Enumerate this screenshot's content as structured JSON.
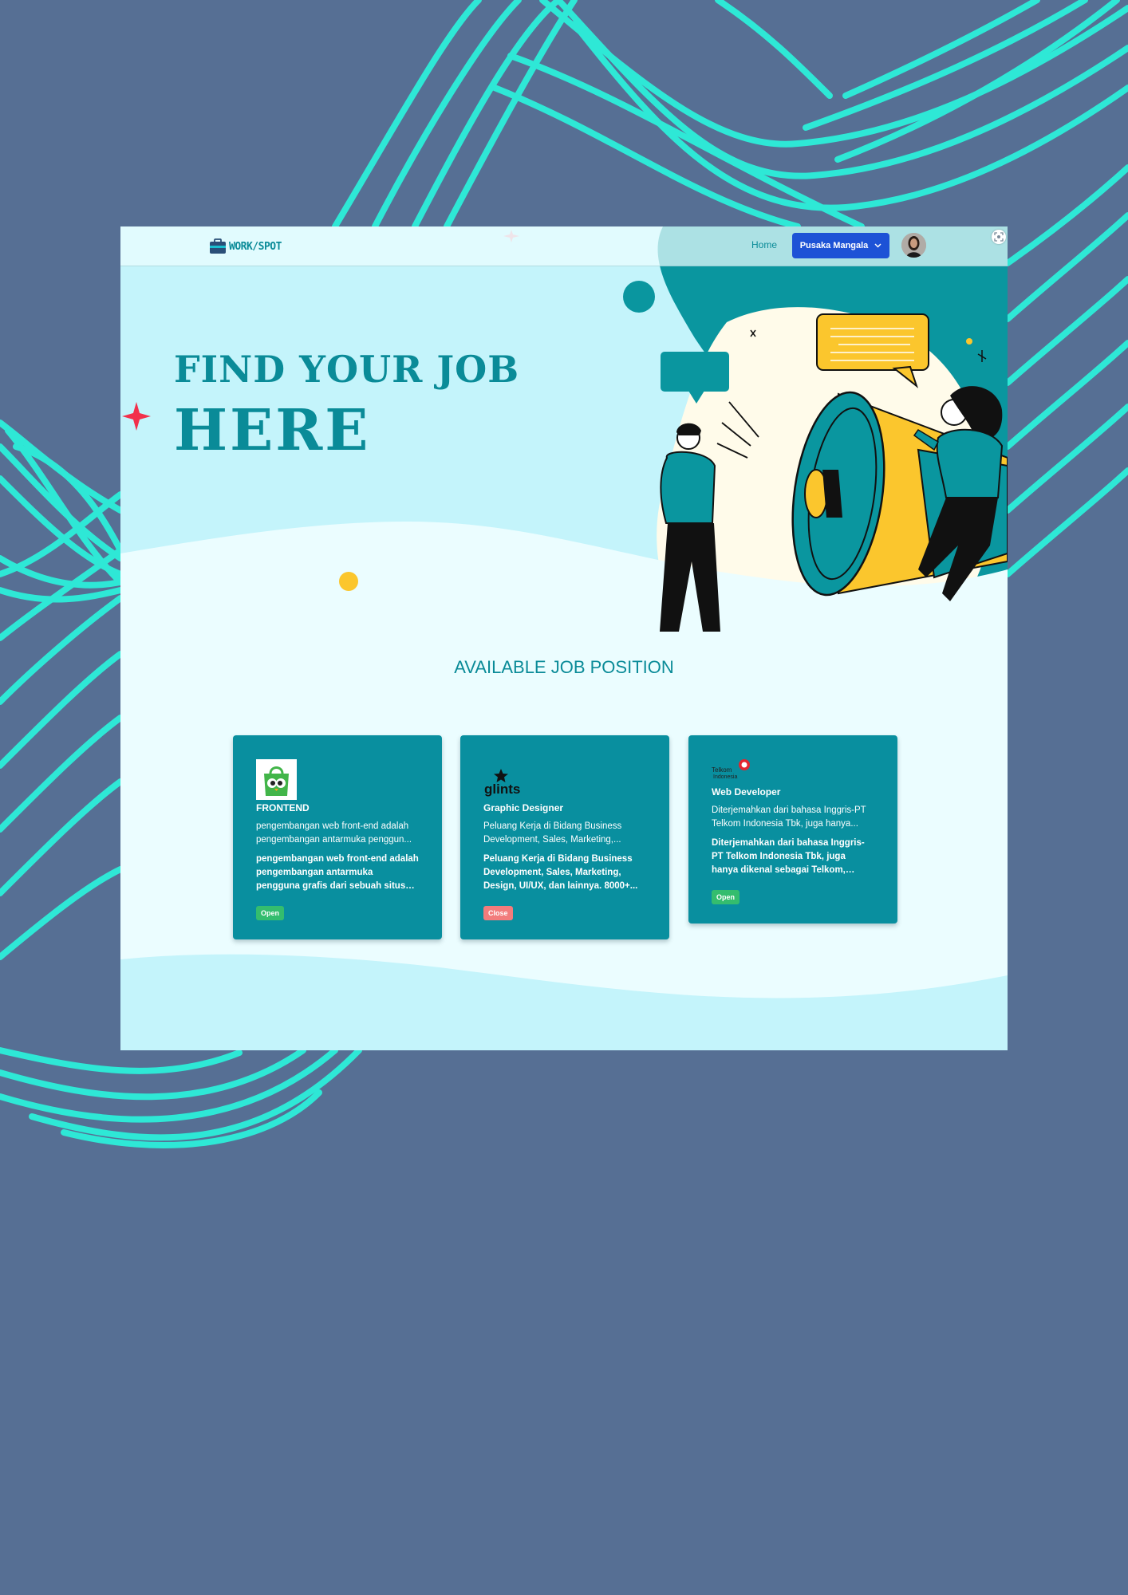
{
  "colors": {
    "background": "#566f94",
    "wave_lines": "#2ee8d6",
    "teal": "#0a8b98",
    "card_bg": "#098f9f",
    "hero_bg": "#c4f4fb",
    "page_bg": "#ebfdff",
    "primary_button": "#1d52d6",
    "badge_open": "#34bd6e",
    "badge_close": "#f27c7c",
    "accent_yellow": "#fbc62d",
    "accent_red": "#f2304b"
  },
  "navbar": {
    "logo_text": "WORK/SPOT",
    "logo_icon": "briefcase-icon",
    "home_label": "Home",
    "user_name": "Pusaka Mangala",
    "dropdown_icon": "chevron-down-icon",
    "corner_icon": "screenshot-icon"
  },
  "hero": {
    "title_line1": "FIND YOUR JOB",
    "title_line2": "HERE",
    "illustration": "megaphone-people-illustration"
  },
  "section": {
    "title": "AVAILABLE JOB POSITION"
  },
  "jobs": [
    {
      "company_logo": "tokopedia-logo",
      "title": "FRONTEND",
      "summary": "pengembangan web front-end adalah pengembangan antarmuka pengguna grafis dari sebuah situs web",
      "summary_visible": "pengembangan web front-end adalah pengembangan antarmuka penggun...",
      "description": "pengembangan web front-end adalah pengembangan antarmuka pengguna grafis dari sebuah situs web, melalui...",
      "status": "Open"
    },
    {
      "company_logo": "glints-logo",
      "logo_text": "glints",
      "title": "Graphic Designer",
      "summary": "Peluang Kerja di Bidang Business Development, Sales, Marketing,...",
      "description": "Peluang Kerja di Bidang Business Development, Sales, Marketing, Design, UI/UX, dan lainnya. 8000+...",
      "status": "Close"
    },
    {
      "company_logo": "telkom-indonesia-logo",
      "logo_text_1": "Telkom",
      "logo_text_2": "Indonesia",
      "title": "Web Developer",
      "summary": "Diterjemahkan dari bahasa Inggris-PT Telkom Indonesia Tbk, juga hanya...",
      "description": "Diterjemahkan dari bahasa Inggris-PT Telkom Indonesia Tbk, juga hanya dikenal sebagai Telkom, adalah...",
      "status": "Open"
    }
  ]
}
